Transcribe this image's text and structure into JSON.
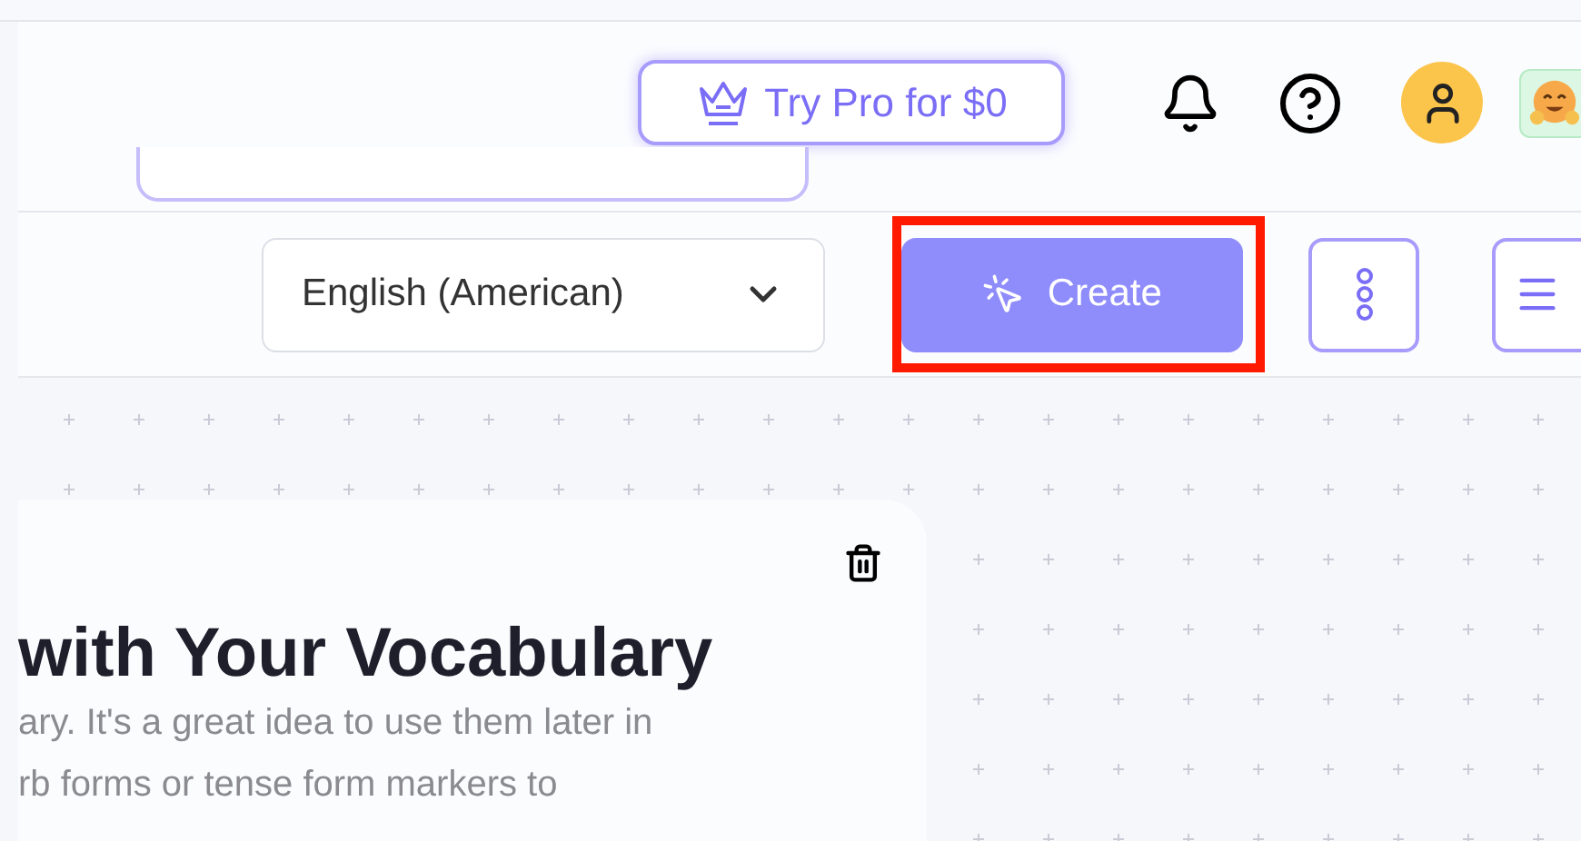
{
  "header": {
    "pro_button": "Try Pro for $0"
  },
  "toolbar": {
    "language_select": "English (American)",
    "create_button": "Create",
    "create_highlighted": true
  },
  "card": {
    "title": "with Your Vocabulary",
    "lines": [
      "ary. It's a great idea to use them later in",
      "rb forms or tense form markers to"
    ]
  }
}
